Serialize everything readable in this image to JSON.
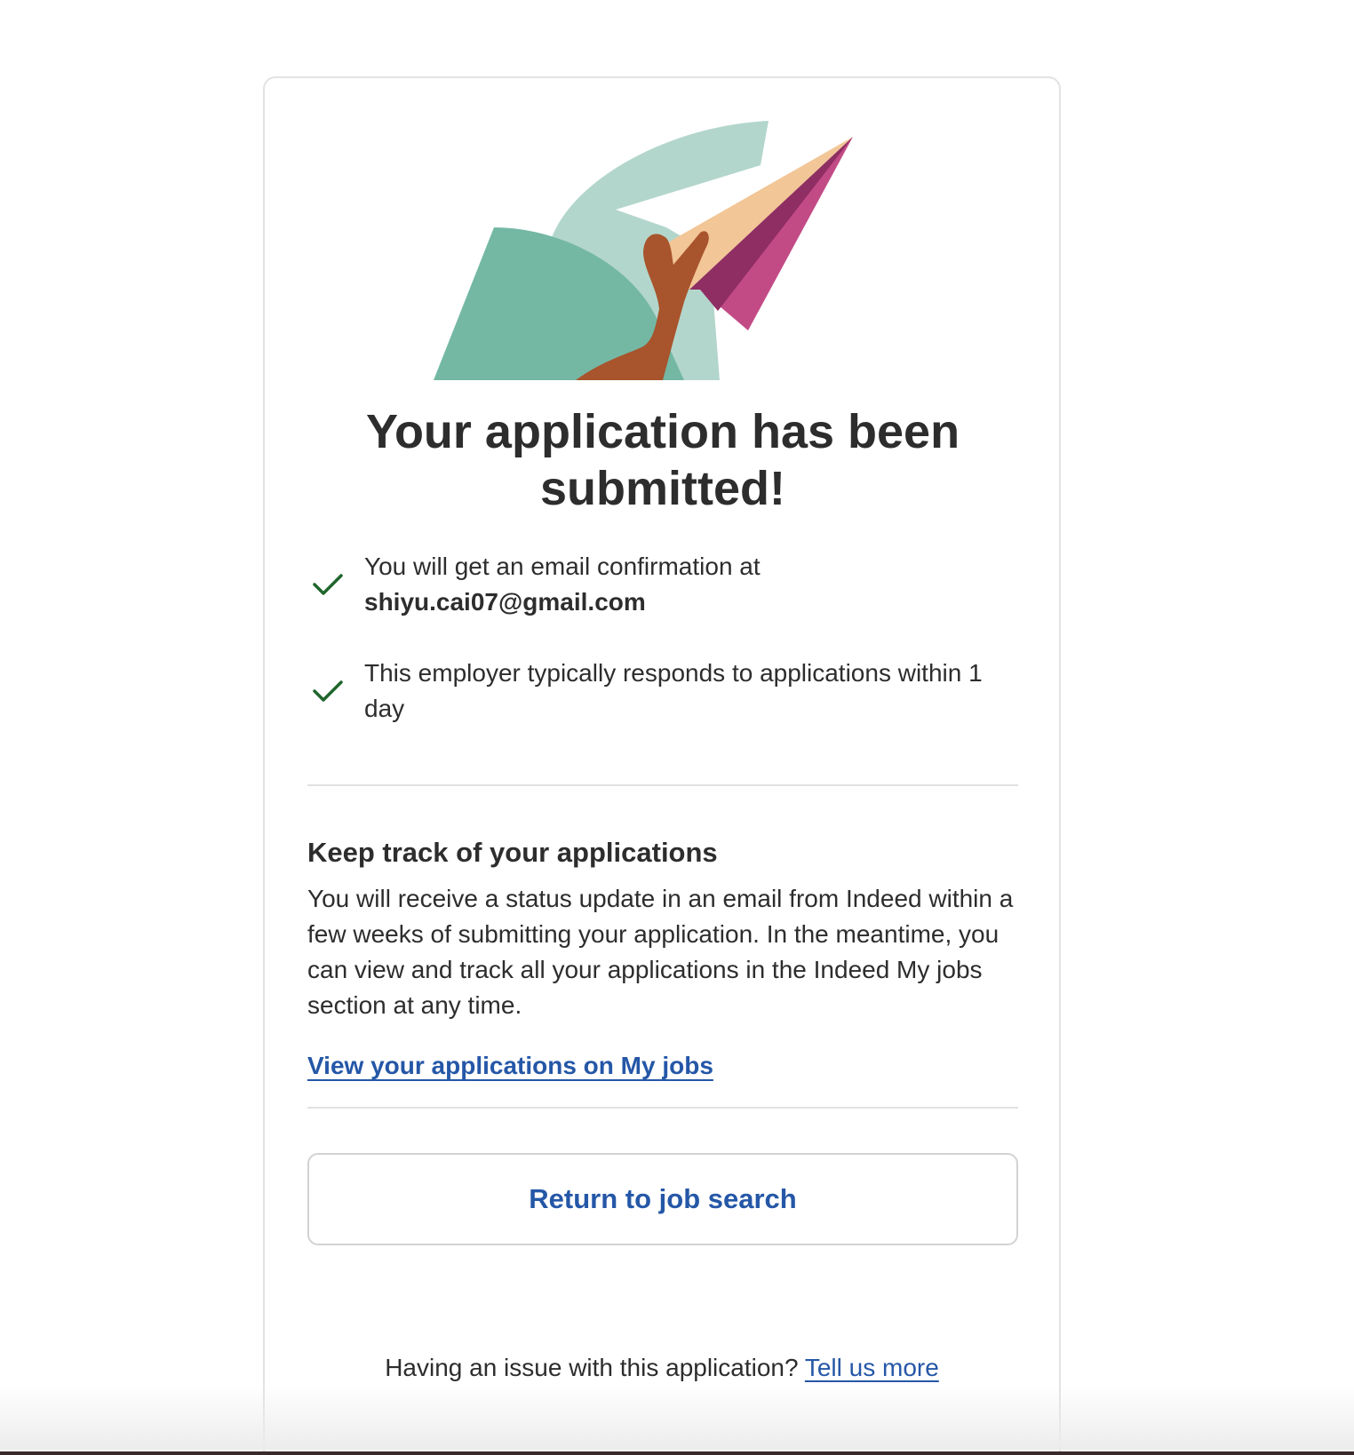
{
  "confirmation": {
    "title": "Your application has been submitted!",
    "checks": [
      {
        "text": "You will get an email confirmation at",
        "email": "shiyu.cai07@gmail.com"
      },
      {
        "text": "This employer typically responds to applications within 1 day"
      }
    ]
  },
  "track": {
    "heading": "Keep track of your applications",
    "body": "You will receive a status update in an email from Indeed within a few weeks of submitting your application. In the meantime, you can view and track all your applications in the Indeed My jobs section at any time.",
    "link_label": "View your applications on My jobs"
  },
  "actions": {
    "return_label": "Return to job search"
  },
  "footer": {
    "question": "Having an issue with this application?",
    "link_label": "Tell us more"
  },
  "icons": {
    "check": "check-icon",
    "illustration": "paper-plane-hand-illustration"
  },
  "colors": {
    "link": "#2557a7",
    "check": "#1f662c",
    "text": "#2d2d2d"
  }
}
